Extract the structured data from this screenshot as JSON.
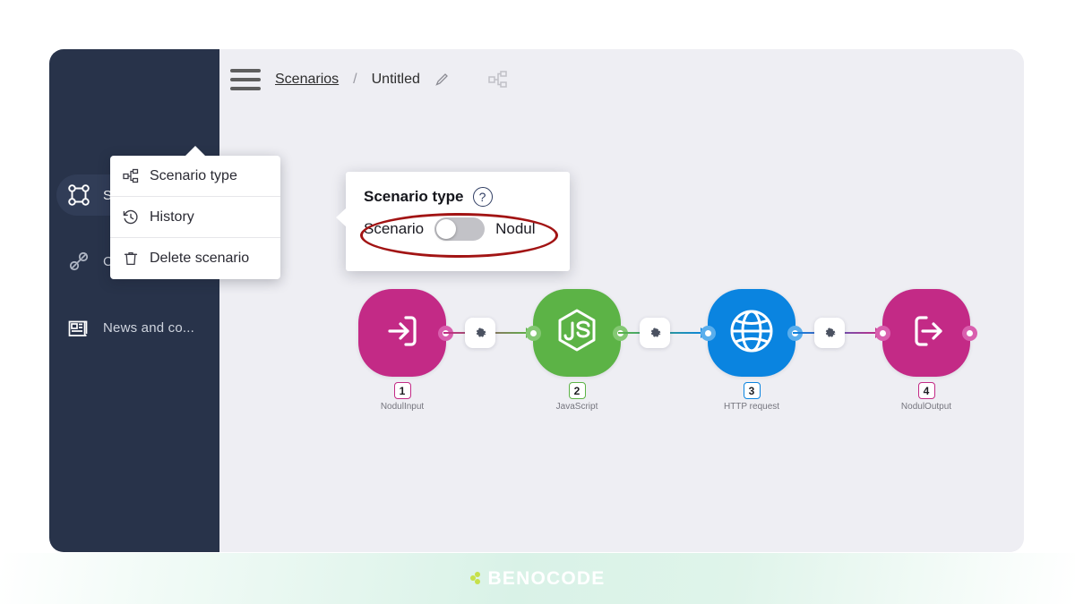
{
  "app": {
    "sidebar": {
      "items": [
        {
          "label": "Scenarios",
          "icon": "scenarios-icon",
          "active": true
        },
        {
          "label": "Connect",
          "icon": "connector-icon",
          "active": false
        },
        {
          "label": "News and co...",
          "icon": "news-icon",
          "active": false
        }
      ]
    },
    "topbar": {
      "menu_icon": "hamburger-icon",
      "breadcrumb_root": "Scenarios",
      "breadcrumb_sep": "/",
      "breadcrumb_title": "Untitled",
      "edit_icon": "pencil-icon",
      "scenario_type_icon": "scenario-type-icon"
    },
    "dropdown": {
      "items": [
        {
          "label": "Scenario type",
          "icon": "scenario-type-icon"
        },
        {
          "label": "History",
          "icon": "history-icon"
        },
        {
          "label": "Delete scenario",
          "icon": "trash-icon"
        }
      ]
    },
    "popover": {
      "title": "Scenario type",
      "help_icon": "question-mark-icon",
      "help_glyph": "?",
      "left_option": "Scenario",
      "right_option": "Nodul",
      "toggle_state": "left",
      "annotation_color": "#a21414"
    },
    "flow": {
      "nodes": [
        {
          "number": "1",
          "name": "NodulInput",
          "icon": "login-arrow-icon",
          "color": "#c32a86"
        },
        {
          "number": "2",
          "name": "JavaScript",
          "icon": "nodejs-js-icon",
          "color": "#5cb346"
        },
        {
          "number": "3",
          "name": "HTTP request",
          "icon": "globe-icon",
          "color": "#0a84e0"
        },
        {
          "number": "4",
          "name": "NodulOutput",
          "icon": "logout-arrow-icon",
          "color": "#c32a86"
        }
      ],
      "connector_icon": "gear-icon"
    },
    "promo": {
      "logo_icon": "benocode-dots-icon",
      "brand": "BENOCODE",
      "brand_color": "#ffffff",
      "dot_color": "#c6e04a"
    }
  }
}
